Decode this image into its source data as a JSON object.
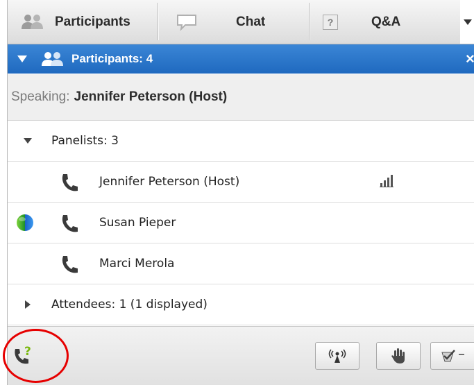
{
  "tabs": {
    "participants": "Participants",
    "chat": "Chat",
    "qa": "Q&A",
    "qa_icon": "?"
  },
  "header": {
    "title": "Participants: 4"
  },
  "speaking": {
    "label": "Speaking:",
    "name": "Jennifer Peterson (Host)"
  },
  "panelists": {
    "label": "Panelists: 3",
    "members": [
      {
        "name": "Jennifer Peterson (Host)",
        "icon": "phone-icon",
        "extra": "signal-bars-icon"
      },
      {
        "name": "Susan Pieper",
        "icon": "phone-icon",
        "status": "globe-icon"
      },
      {
        "name": "Marci Merola",
        "icon": "phone-icon"
      }
    ]
  },
  "attendees": {
    "label": "Attendees: 1 (1 displayed)"
  },
  "toolbar": {
    "buttons": [
      "call-question-icon",
      "broadcast-icon",
      "raise-hand-icon",
      "checkmark-menu-icon"
    ]
  },
  "colors": {
    "header_blue": "#2574c9",
    "highlight_red": "#e60000",
    "call_green": "#7ab80e"
  }
}
